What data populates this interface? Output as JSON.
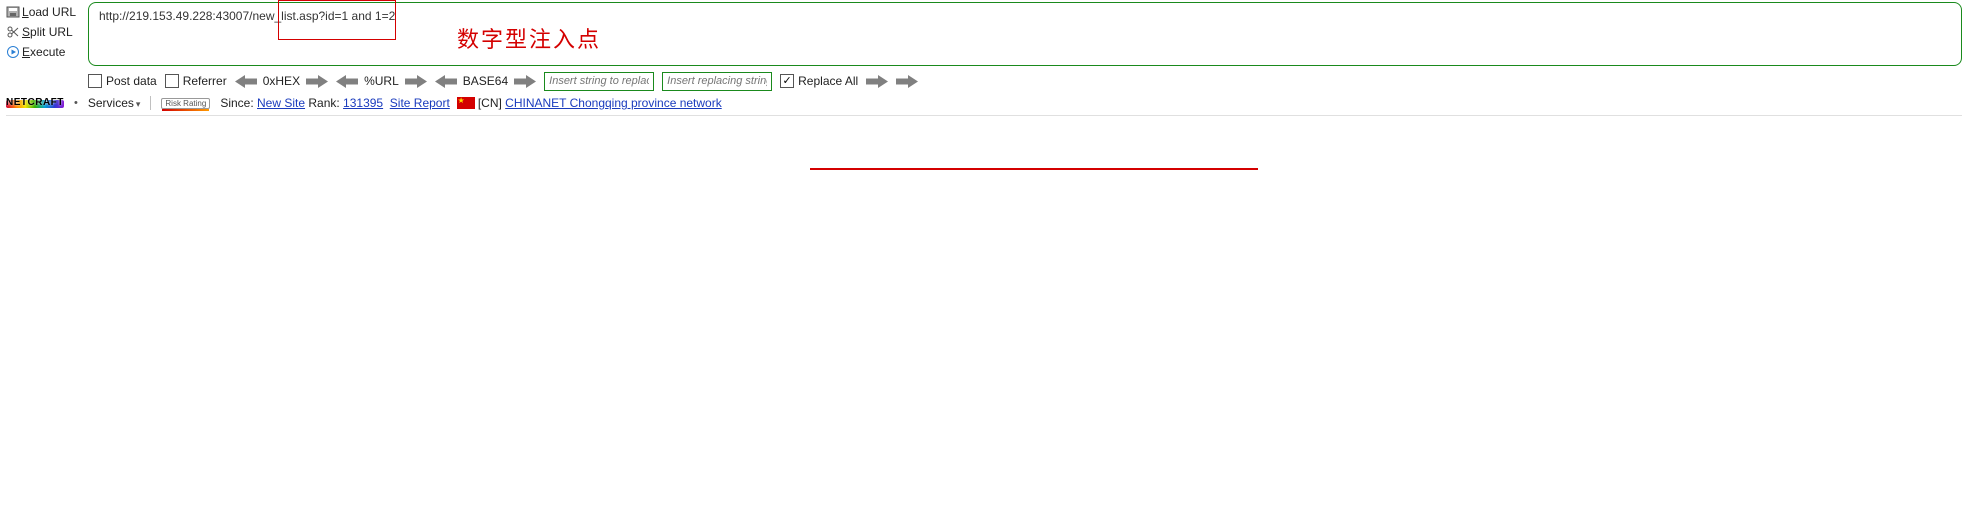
{
  "left_buttons": {
    "load": "Load URL",
    "load_u": "L",
    "split": "Split URL",
    "split_u": "S",
    "execute": "Execute",
    "execute_u": "E"
  },
  "url": "http://219.153.49.228:43007/new_list.asp?id=1 and 1=2",
  "annotation": "数字型注入点",
  "options": {
    "post_data": "Post data",
    "referrer": "Referrer",
    "hex": "0xHEX",
    "url_enc": "%URL",
    "base64": "BASE64",
    "insert_replace_ph": "Insert string to replace",
    "insert_replacing_ph": "Insert replacing string",
    "replace_all": "Replace All"
  },
  "netcraft": {
    "logo_text": "NETCRAFT",
    "services": "Services",
    "risk": "Risk Rating",
    "since_label": "Since: ",
    "since_link": "New Site",
    "rank_label": " Rank: ",
    "rank_link": "131395",
    "site_report": "Site Report",
    "country_code": " [CN] ",
    "net_link": "CHINANET Chongqing province network"
  }
}
